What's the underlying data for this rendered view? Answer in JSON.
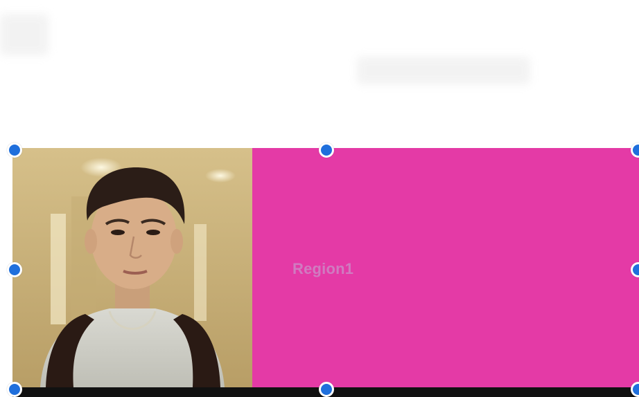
{
  "region": {
    "label": "Region1",
    "fill_color": "#e43aa6",
    "handle_color": "#1f6fdc"
  },
  "photo": {
    "description_icon": "portrait-photo"
  },
  "handles": [
    {
      "name": "resize-handle-top-left"
    },
    {
      "name": "resize-handle-top-center"
    },
    {
      "name": "resize-handle-top-right"
    },
    {
      "name": "resize-handle-middle-left"
    },
    {
      "name": "resize-handle-middle-right"
    },
    {
      "name": "resize-handle-bottom-left"
    },
    {
      "name": "resize-handle-bottom-center"
    },
    {
      "name": "resize-handle-bottom-right"
    }
  ]
}
